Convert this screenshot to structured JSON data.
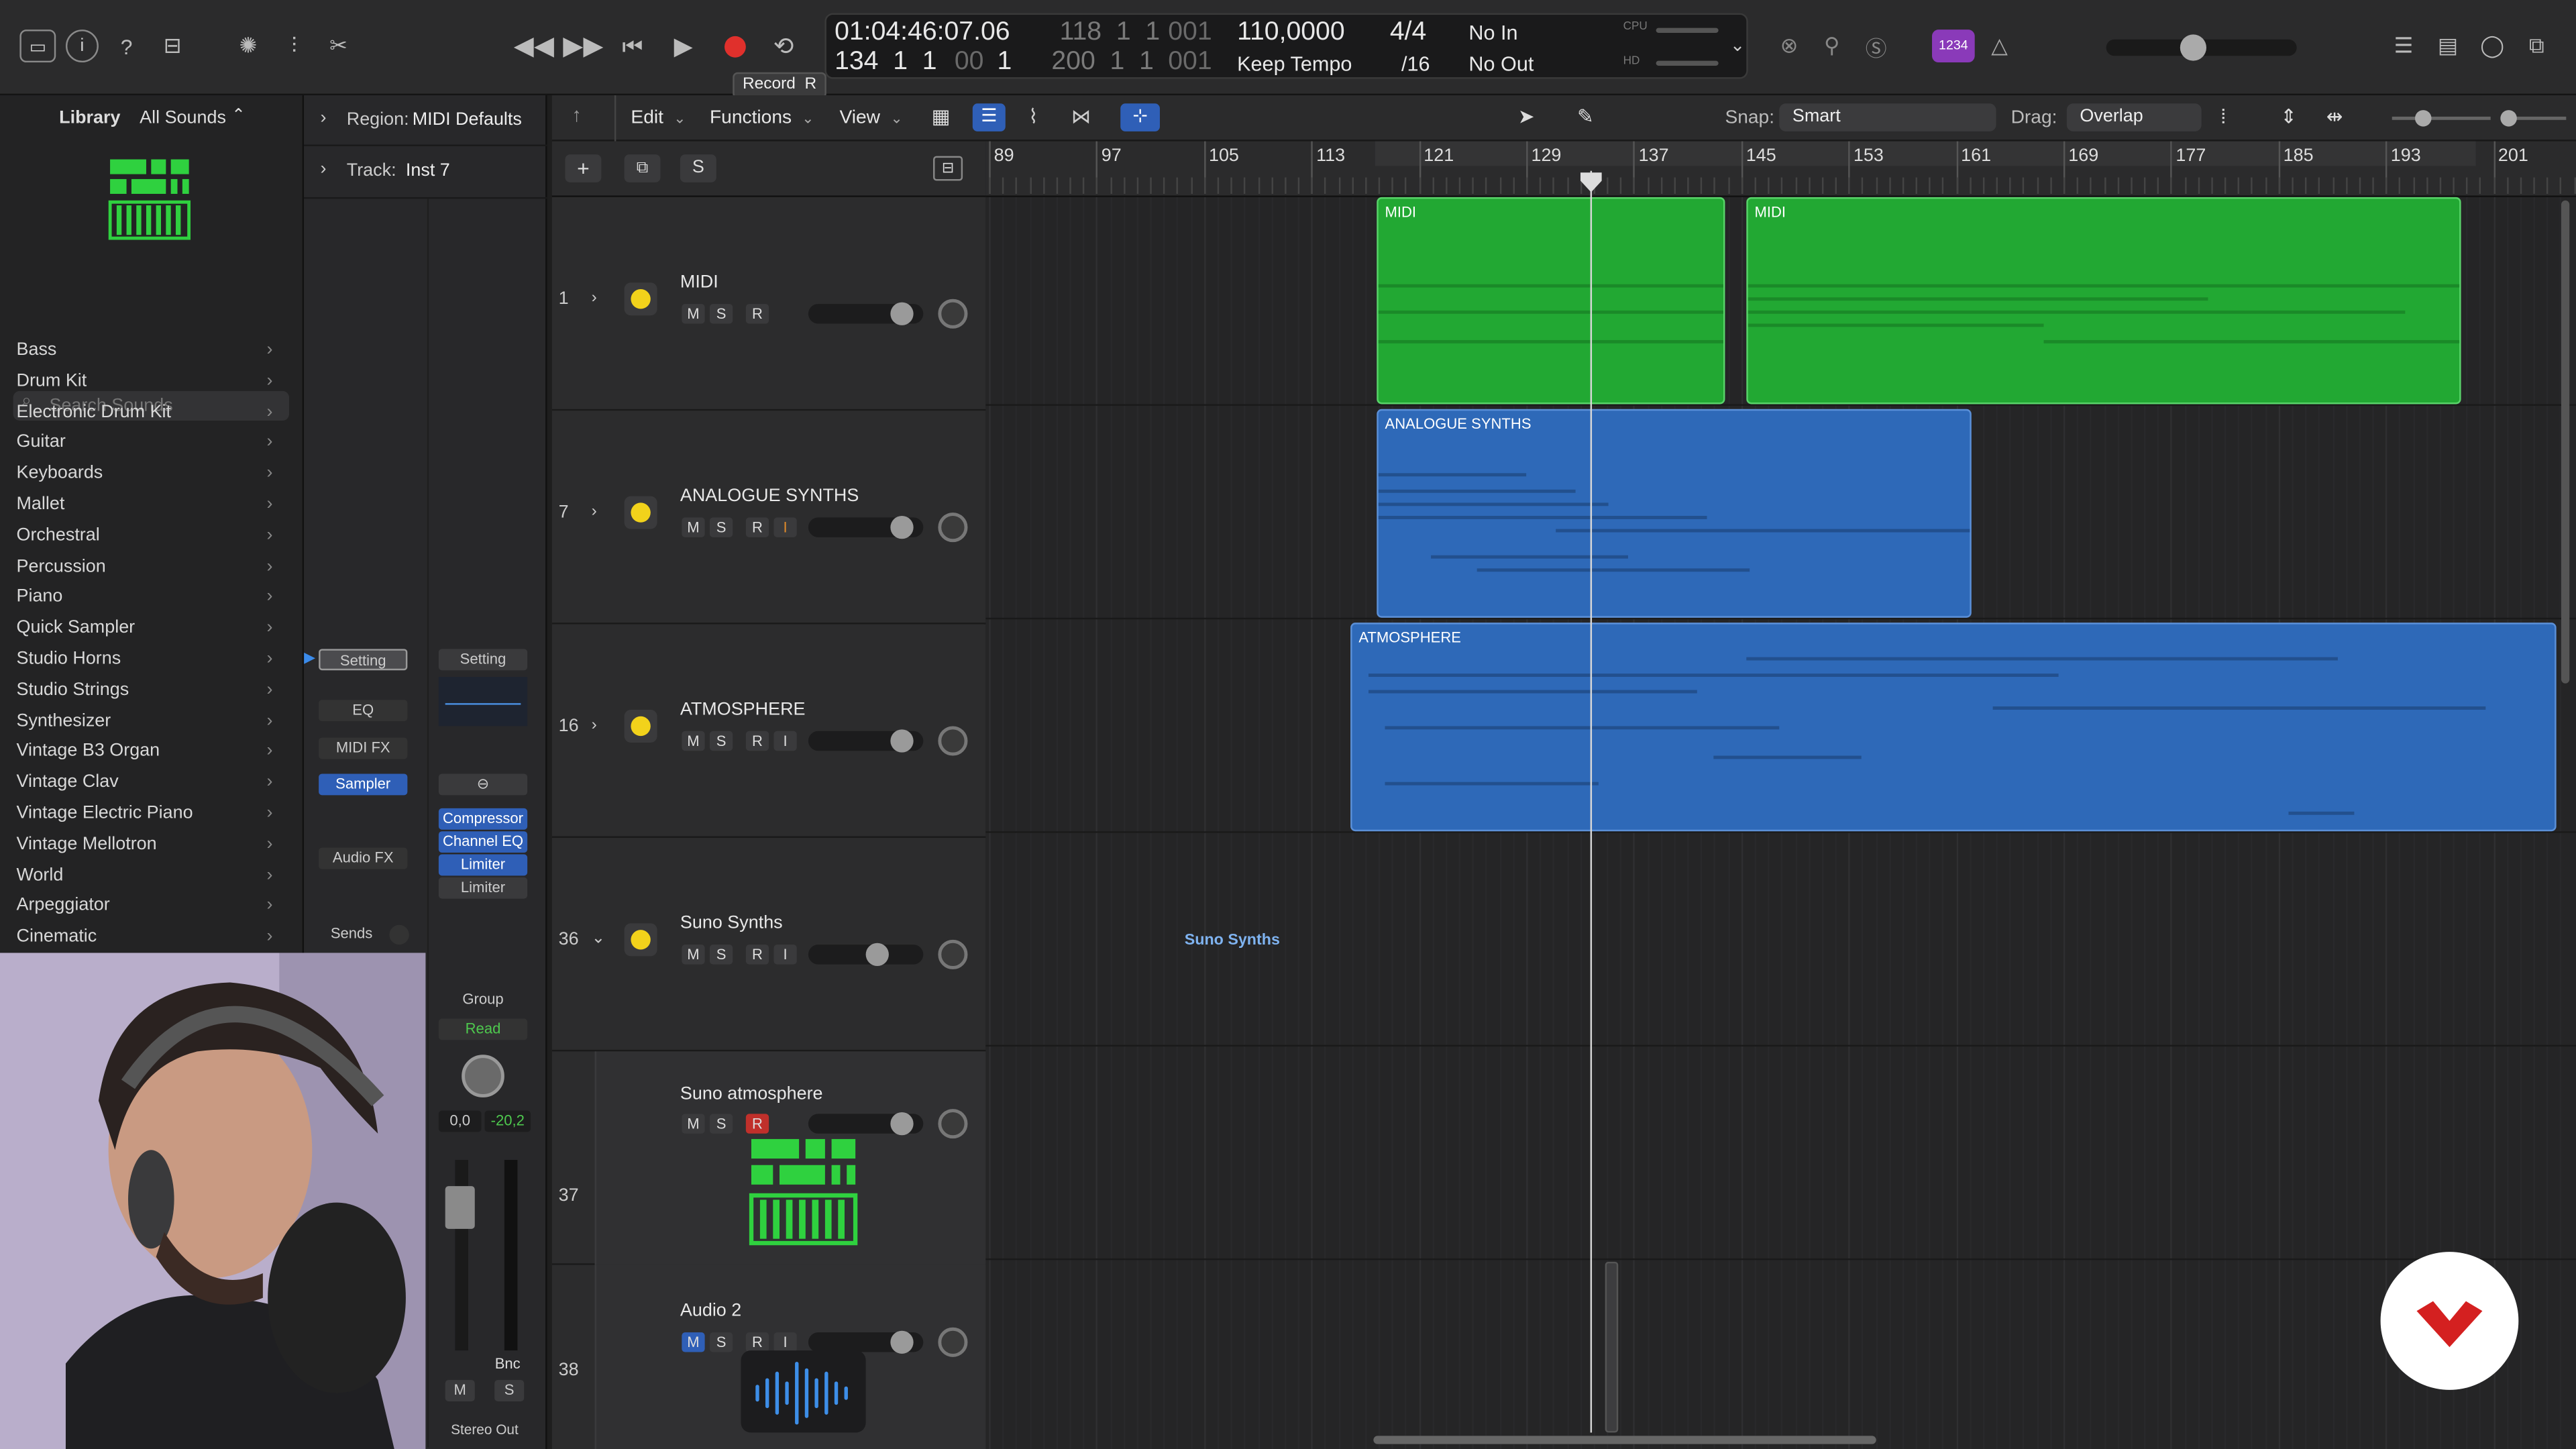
{
  "control_bar": {
    "tooltip": "Record  R",
    "lcd": {
      "time": "01:04:46:07.06",
      "bar_pos": "118  1  1",
      "bar_pos_dim": "001",
      "end_pos": "134  1  1",
      "end_dim": "00",
      "end_last": "1",
      "end_bar": "200  1  1",
      "end_bar_dim": "001",
      "tempo": "110,0000",
      "tempo_mode": "Keep Tempo",
      "signature": "4/4",
      "division": "/16",
      "midi_in": "No In",
      "midi_out": "No Out",
      "cpu_label": "CPU",
      "hd_label": "HD"
    },
    "count_in_badge": "1234"
  },
  "library": {
    "title": "Library",
    "filter": "All Sounds",
    "search_placeholder": "Search Sounds",
    "items": [
      "Bass",
      "Drum Kit",
      "Electronic Drum Kit",
      "Guitar",
      "Keyboards",
      "Mallet",
      "Orchestral",
      "Percussion",
      "Piano",
      "Quick Sampler",
      "Studio Horns",
      "Studio Strings",
      "Synthesizer",
      "Vintage B3 Organ",
      "Vintage Clav",
      "Vintage Electric Piano",
      "Vintage Mellotron",
      "World",
      "Arpeggiator",
      "Cinematic"
    ]
  },
  "inspector": {
    "region_label": "Region:",
    "region_value": "MIDI Defaults",
    "track_label": "Track:",
    "track_value": "Inst 7",
    "setting": "Setting",
    "setting2": "Setting",
    "eq": "EQ",
    "midi_fx": "MIDI FX",
    "sampler": "Sampler",
    "audio_fx": "Audio FX",
    "sends": "Sends",
    "plugins": [
      "Compressor",
      "Channel EQ",
      "Limiter",
      "Limiter"
    ],
    "group": "Group",
    "read": "Read",
    "vol_left": "0,0",
    "vol_right": "-20,2",
    "bnc": "Bnc",
    "m": "M",
    "s": "S",
    "stereo_out": "Stereo Out"
  },
  "toolbar": {
    "edit": "Edit",
    "functions": "Functions",
    "view": "View",
    "snap_label": "Snap:",
    "snap_value": "Smart",
    "drag_label": "Drag:",
    "drag_value": "Overlap"
  },
  "header_buttons": {
    "s": "S"
  },
  "ruler": [
    "89",
    "97",
    "105",
    "113",
    "121",
    "129",
    "137",
    "145",
    "153",
    "161",
    "169",
    "177",
    "185",
    "193",
    "201"
  ],
  "tracks": [
    {
      "num": "1",
      "name": "MIDI",
      "m": "M",
      "s": "S",
      "r": "R"
    },
    {
      "num": "7",
      "name": "ANALOGUE SYNTHS",
      "m": "M",
      "s": "S",
      "r": "R",
      "i": "I"
    },
    {
      "num": "16",
      "name": "ATMOSPHERE",
      "m": "M",
      "s": "S",
      "r": "R",
      "i": "I"
    },
    {
      "num": "36",
      "name": "Suno Synths",
      "m": "M",
      "s": "S",
      "r": "R",
      "i": "I"
    },
    {
      "num": "37",
      "name": "Suno atmosphere",
      "m": "M",
      "s": "S",
      "r": "R"
    },
    {
      "num": "38",
      "name": "Audio 2",
      "m": "M",
      "s": "S",
      "r": "R",
      "i": "I"
    }
  ],
  "regions": {
    "midi1": "MIDI",
    "midi2": "MIDI",
    "analogue": "ANALOGUE SYNTHS",
    "atmosphere": "ATMOSPHERE",
    "suno_label": "Suno Synths"
  },
  "colors": {
    "midi_green": "#22a833",
    "blue_region": "#2e69b8",
    "record_red": "#e0302c",
    "accent_blue": "#2f5fb7"
  }
}
